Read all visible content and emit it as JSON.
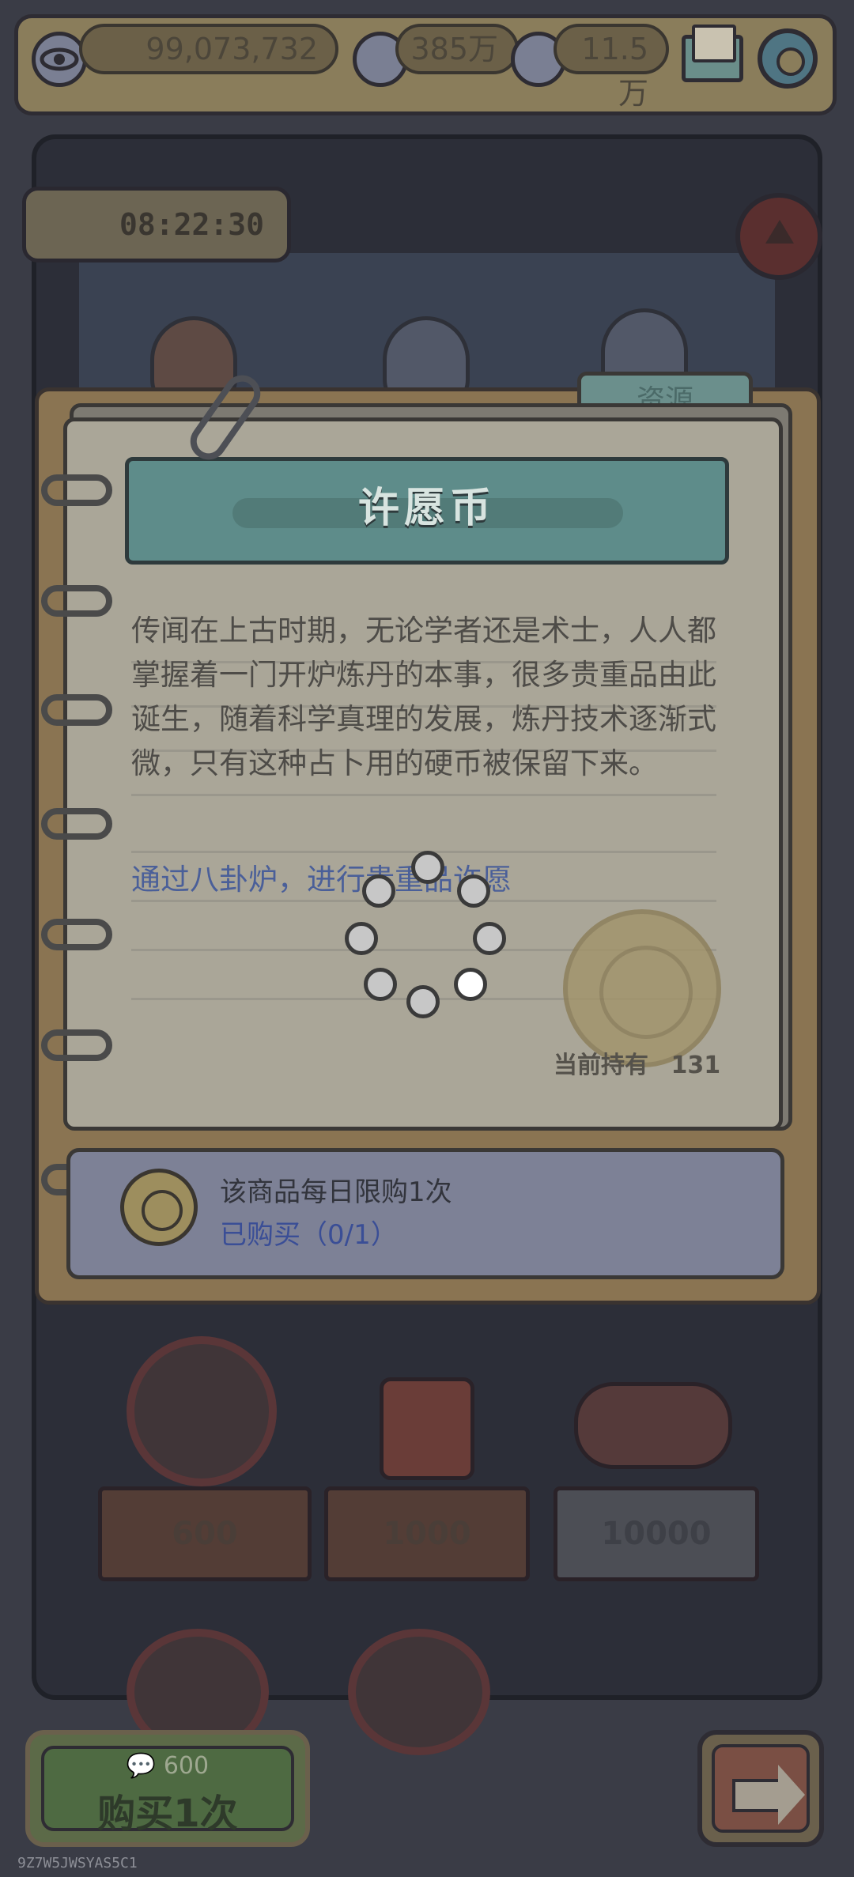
{
  "topbar": {
    "view_count": "99,073,732",
    "ghost_currency": "385万",
    "chat_currency": "11.5万",
    "icons": [
      "eye-icon",
      "ghost-icon",
      "speech-bubble-icon",
      "mail-icon",
      "gear-icon"
    ]
  },
  "machine": {
    "timer": "08:22:30",
    "shelves": [
      {
        "price": "600"
      },
      {
        "price": "1000"
      },
      {
        "price": "10000"
      }
    ]
  },
  "dialog": {
    "tab_label": "资源",
    "title": "许愿币",
    "description": "传闻在上古时期，无论学者还是术士，人人都掌握着一门开炉炼丹的本事，很多贵重品由此诞生，随着科学真理的发展，炼丹技术逐渐式微，只有这种占卜用的硬币被保留下来。",
    "source_link": "通过八卦炉，进行贵重品许愿",
    "held_label": "当前持有",
    "held_count": "131",
    "limit_text": "该商品每日限购1次",
    "bought_text": "已购买（0/1）"
  },
  "bottom": {
    "buy_cost": "600",
    "buy_label": "购买1次",
    "footer_code": "9Z7W5JWSYAS5C1"
  },
  "colors": {
    "overlay_dim": "#3a3c46",
    "title_teal": "#5e8c8a",
    "link_blue": "#4a5f99"
  }
}
